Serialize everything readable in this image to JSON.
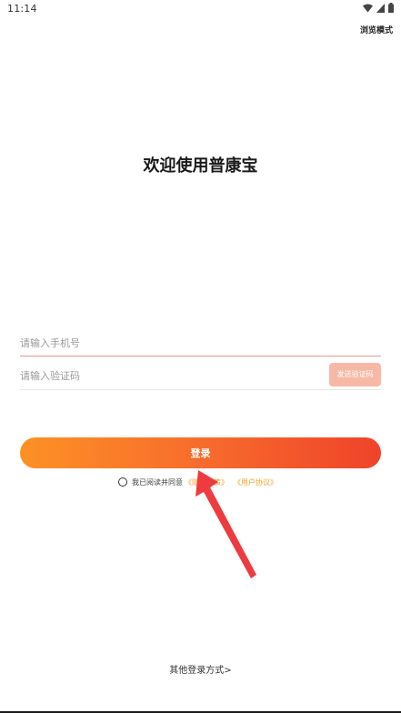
{
  "status_bar": {
    "time": "11:14",
    "icons": [
      "wifi-icon",
      "signal-icon",
      "battery-icon"
    ]
  },
  "header": {
    "browse_mode_label": "浏览模式"
  },
  "welcome": {
    "title": "欢迎使用普康宝"
  },
  "form": {
    "phone_placeholder": "请输入手机号",
    "phone_value": "",
    "code_placeholder": "请输入验证码",
    "code_value": "",
    "send_code_label": "发送验证码",
    "login_label": "登录"
  },
  "agreement": {
    "checked": false,
    "text": "我已阅读并同意",
    "policy_link": "《隐私政策》",
    "terms_link": "《用户协议》"
  },
  "footer": {
    "other_login_label": "其他登录方式>"
  },
  "colors": {
    "accent_gradient_start": "#fd9125",
    "accent_gradient_end": "#ef432a",
    "send_code_bg": "#f7b9a6",
    "link_color": "#f0a32c",
    "arrow_color": "#ee3b3f"
  }
}
